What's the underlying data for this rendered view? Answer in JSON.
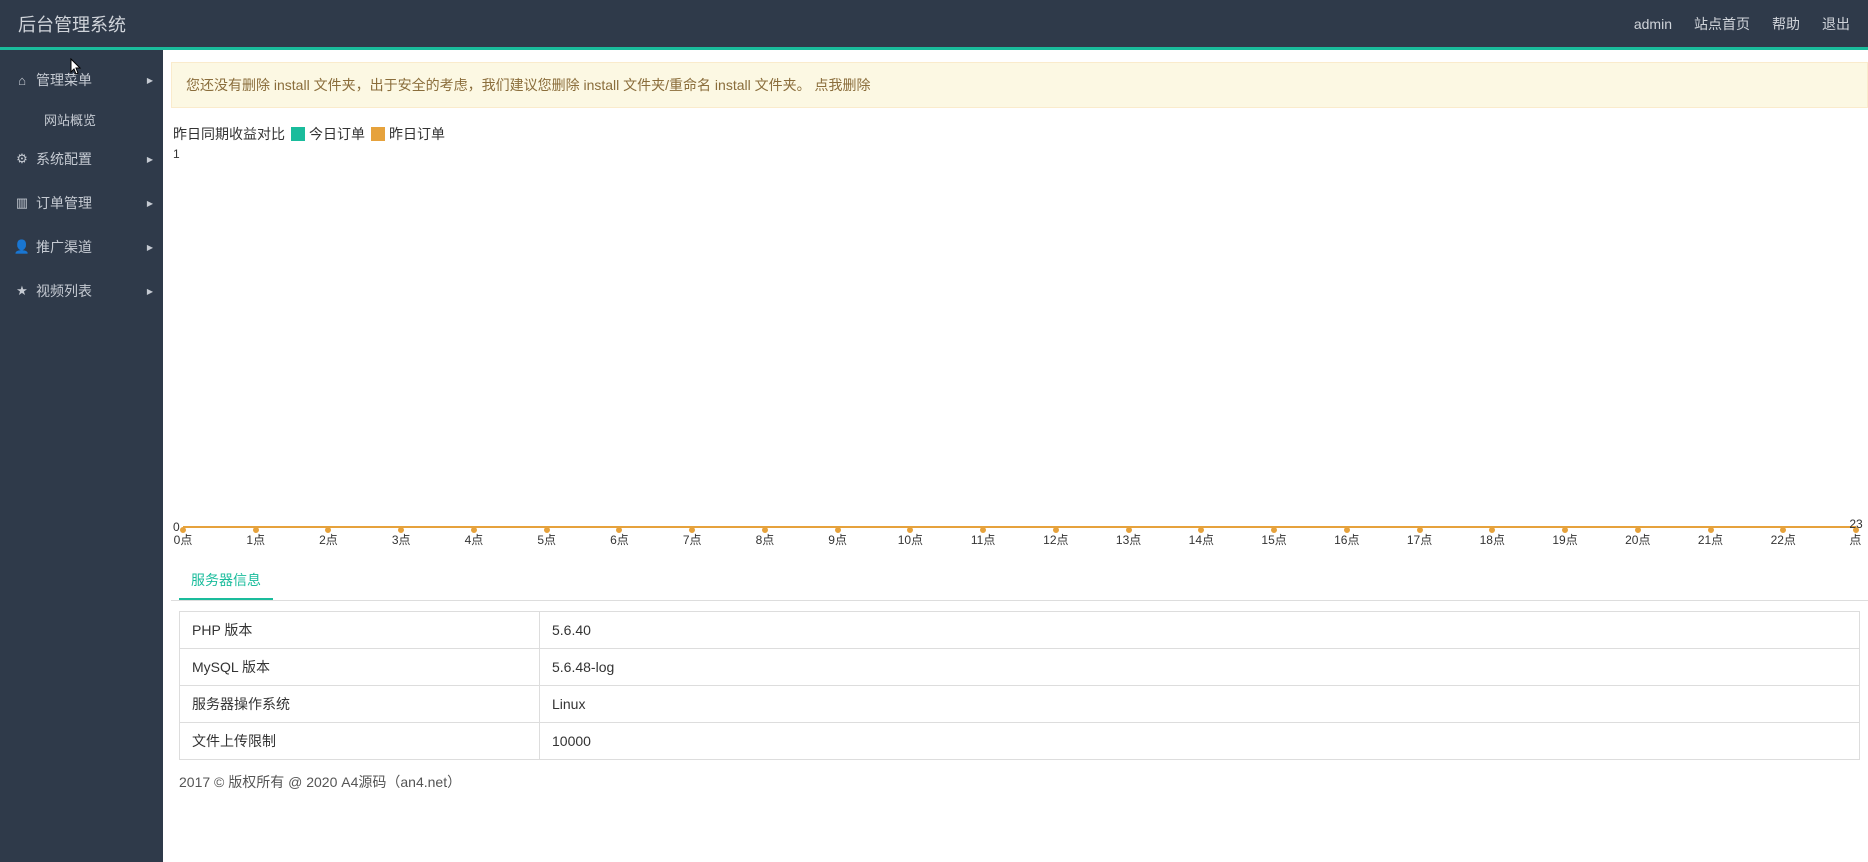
{
  "header": {
    "brand": "后台管理系统",
    "links": [
      "admin",
      "站点首页",
      "帮助",
      "退出"
    ]
  },
  "sidebar": {
    "items": [
      {
        "icon": "home",
        "label": "管理菜单",
        "sub": [
          "网站概览"
        ]
      },
      {
        "icon": "cogs",
        "label": "系统配置"
      },
      {
        "icon": "chart",
        "label": "订单管理"
      },
      {
        "icon": "user",
        "label": "推广渠道"
      },
      {
        "icon": "star",
        "label": "视频列表"
      }
    ]
  },
  "alert": {
    "text": "您还没有删除 install 文件夹，出于安全的考虑，我们建议您删除 install 文件夹/重命名 install 文件夹。 ",
    "link": "点我删除"
  },
  "chart_data": {
    "type": "line",
    "title": "昨日同期收益对比",
    "series": [
      {
        "name": "今日订单",
        "color": "#1abc9c",
        "values": [
          0,
          0,
          0,
          0,
          0,
          0,
          0,
          0,
          0,
          0,
          0,
          0,
          0,
          0,
          0,
          0,
          0,
          0,
          0,
          0,
          0,
          0,
          0,
          0
        ]
      },
      {
        "name": "昨日订单",
        "color": "#e6a23c",
        "values": [
          0,
          0,
          0,
          0,
          0,
          0,
          0,
          0,
          0,
          0,
          0,
          0,
          0,
          0,
          0,
          0,
          0,
          0,
          0,
          0,
          0,
          0,
          0,
          0
        ]
      }
    ],
    "categories": [
      "0点",
      "1点",
      "2点",
      "3点",
      "4点",
      "5点",
      "6点",
      "7点",
      "8点",
      "9点",
      "10点",
      "11点",
      "12点",
      "13点",
      "14点",
      "15点",
      "16点",
      "17点",
      "18点",
      "19点",
      "20点",
      "21点",
      "22点",
      "23点"
    ],
    "ylim": [
      0,
      1
    ],
    "yticks": [
      0,
      1
    ]
  },
  "tabs": {
    "active": "服务器信息"
  },
  "server_info": [
    {
      "k": "PHP 版本",
      "v": "5.6.40"
    },
    {
      "k": "MySQL 版本",
      "v": "5.6.48-log"
    },
    {
      "k": "服务器操作系统",
      "v": "Linux"
    },
    {
      "k": "文件上传限制",
      "v": "10000"
    }
  ],
  "footer": "2017 © 版权所有 @ 2020 A4源码（an4.net）",
  "icons": {
    "home": "⌂",
    "cogs": "⚙",
    "chart": "▥",
    "user": "👤",
    "star": "★",
    "caret": "▶"
  }
}
